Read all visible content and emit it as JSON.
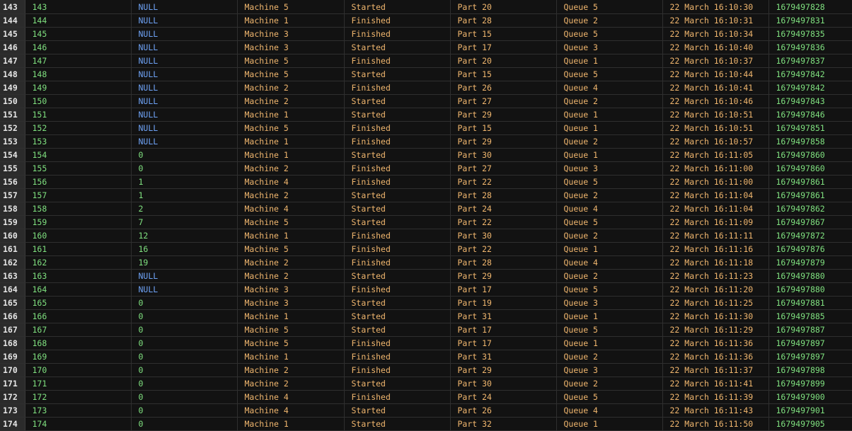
{
  "colors": {
    "background": "#121212",
    "row_number_bg": "#2b2b2b",
    "numeric": "#7fe07f",
    "null": "#6ea2f5",
    "string": "#f0b66e"
  },
  "rows": [
    {
      "rn": "143",
      "id": "143",
      "v": "NULL",
      "machine": "Machine 5",
      "status": "Started",
      "part": "Part 20",
      "queue": "Queue 5",
      "date": "22 March 16:10:30",
      "ts": "1679497828"
    },
    {
      "rn": "144",
      "id": "144",
      "v": "NULL",
      "machine": "Machine 1",
      "status": "Finished",
      "part": "Part 28",
      "queue": "Queue 2",
      "date": "22 March 16:10:31",
      "ts": "1679497831"
    },
    {
      "rn": "145",
      "id": "145",
      "v": "NULL",
      "machine": "Machine 3",
      "status": "Finished",
      "part": "Part 15",
      "queue": "Queue 5",
      "date": "22 March 16:10:34",
      "ts": "1679497835"
    },
    {
      "rn": "146",
      "id": "146",
      "v": "NULL",
      "machine": "Machine 3",
      "status": "Started",
      "part": "Part 17",
      "queue": "Queue 3",
      "date": "22 March 16:10:40",
      "ts": "1679497836"
    },
    {
      "rn": "147",
      "id": "147",
      "v": "NULL",
      "machine": "Machine 5",
      "status": "Finished",
      "part": "Part 20",
      "queue": "Queue 1",
      "date": "22 March 16:10:37",
      "ts": "1679497837"
    },
    {
      "rn": "148",
      "id": "148",
      "v": "NULL",
      "machine": "Machine 5",
      "status": "Started",
      "part": "Part 15",
      "queue": "Queue 5",
      "date": "22 March 16:10:44",
      "ts": "1679497842"
    },
    {
      "rn": "149",
      "id": "149",
      "v": "NULL",
      "machine": "Machine 2",
      "status": "Finished",
      "part": "Part 26",
      "queue": "Queue 4",
      "date": "22 March 16:10:41",
      "ts": "1679497842"
    },
    {
      "rn": "150",
      "id": "150",
      "v": "NULL",
      "machine": "Machine 2",
      "status": "Started",
      "part": "Part 27",
      "queue": "Queue 2",
      "date": "22 March 16:10:46",
      "ts": "1679497843"
    },
    {
      "rn": "151",
      "id": "151",
      "v": "NULL",
      "machine": "Machine 1",
      "status": "Started",
      "part": "Part 29",
      "queue": "Queue 1",
      "date": "22 March 16:10:51",
      "ts": "1679497846"
    },
    {
      "rn": "152",
      "id": "152",
      "v": "NULL",
      "machine": "Machine 5",
      "status": "Finished",
      "part": "Part 15",
      "queue": "Queue 1",
      "date": "22 March 16:10:51",
      "ts": "1679497851"
    },
    {
      "rn": "153",
      "id": "153",
      "v": "NULL",
      "machine": "Machine 1",
      "status": "Finished",
      "part": "Part 29",
      "queue": "Queue 2",
      "date": "22 March 16:10:57",
      "ts": "1679497858"
    },
    {
      "rn": "154",
      "id": "154",
      "v": "0",
      "machine": "Machine 1",
      "status": "Started",
      "part": "Part 30",
      "queue": "Queue 1",
      "date": "22 March 16:11:05",
      "ts": "1679497860"
    },
    {
      "rn": "155",
      "id": "155",
      "v": "0",
      "machine": "Machine 2",
      "status": "Finished",
      "part": "Part 27",
      "queue": "Queue 3",
      "date": "22 March 16:11:00",
      "ts": "1679497860"
    },
    {
      "rn": "156",
      "id": "156",
      "v": "1",
      "machine": "Machine 4",
      "status": "Finished",
      "part": "Part 22",
      "queue": "Queue 5",
      "date": "22 March 16:11:00",
      "ts": "1679497861"
    },
    {
      "rn": "157",
      "id": "157",
      "v": "1",
      "machine": "Machine 2",
      "status": "Started",
      "part": "Part 28",
      "queue": "Queue 2",
      "date": "22 March 16:11:04",
      "ts": "1679497861"
    },
    {
      "rn": "158",
      "id": "158",
      "v": "2",
      "machine": "Machine 4",
      "status": "Started",
      "part": "Part 24",
      "queue": "Queue 4",
      "date": "22 March 16:11:04",
      "ts": "1679497862"
    },
    {
      "rn": "159",
      "id": "159",
      "v": "7",
      "machine": "Machine 5",
      "status": "Started",
      "part": "Part 22",
      "queue": "Queue 5",
      "date": "22 March 16:11:09",
      "ts": "1679497867"
    },
    {
      "rn": "160",
      "id": "160",
      "v": "12",
      "machine": "Machine 1",
      "status": "Finished",
      "part": "Part 30",
      "queue": "Queue 2",
      "date": "22 March 16:11:11",
      "ts": "1679497872"
    },
    {
      "rn": "161",
      "id": "161",
      "v": "16",
      "machine": "Machine 5",
      "status": "Finished",
      "part": "Part 22",
      "queue": "Queue 1",
      "date": "22 March 16:11:16",
      "ts": "1679497876"
    },
    {
      "rn": "162",
      "id": "162",
      "v": "19",
      "machine": "Machine 2",
      "status": "Finished",
      "part": "Part 28",
      "queue": "Queue 4",
      "date": "22 March 16:11:18",
      "ts": "1679497879"
    },
    {
      "rn": "163",
      "id": "163",
      "v": "NULL",
      "machine": "Machine 2",
      "status": "Started",
      "part": "Part 29",
      "queue": "Queue 2",
      "date": "22 March 16:11:23",
      "ts": "1679497880"
    },
    {
      "rn": "164",
      "id": "164",
      "v": "NULL",
      "machine": "Machine 3",
      "status": "Finished",
      "part": "Part 17",
      "queue": "Queue 5",
      "date": "22 March 16:11:20",
      "ts": "1679497880"
    },
    {
      "rn": "165",
      "id": "165",
      "v": "0",
      "machine": "Machine 3",
      "status": "Started",
      "part": "Part 19",
      "queue": "Queue 3",
      "date": "22 March 16:11:25",
      "ts": "1679497881"
    },
    {
      "rn": "166",
      "id": "166",
      "v": "0",
      "machine": "Machine 1",
      "status": "Started",
      "part": "Part 31",
      "queue": "Queue 1",
      "date": "22 March 16:11:30",
      "ts": "1679497885"
    },
    {
      "rn": "167",
      "id": "167",
      "v": "0",
      "machine": "Machine 5",
      "status": "Started",
      "part": "Part 17",
      "queue": "Queue 5",
      "date": "22 March 16:11:29",
      "ts": "1679497887"
    },
    {
      "rn": "168",
      "id": "168",
      "v": "0",
      "machine": "Machine 5",
      "status": "Finished",
      "part": "Part 17",
      "queue": "Queue 1",
      "date": "22 March 16:11:36",
      "ts": "1679497897"
    },
    {
      "rn": "169",
      "id": "169",
      "v": "0",
      "machine": "Machine 1",
      "status": "Finished",
      "part": "Part 31",
      "queue": "Queue 2",
      "date": "22 March 16:11:36",
      "ts": "1679497897"
    },
    {
      "rn": "170",
      "id": "170",
      "v": "0",
      "machine": "Machine 2",
      "status": "Finished",
      "part": "Part 29",
      "queue": "Queue 3",
      "date": "22 March 16:11:37",
      "ts": "1679497898"
    },
    {
      "rn": "171",
      "id": "171",
      "v": "0",
      "machine": "Machine 2",
      "status": "Started",
      "part": "Part 30",
      "queue": "Queue 2",
      "date": "22 March 16:11:41",
      "ts": "1679497899"
    },
    {
      "rn": "172",
      "id": "172",
      "v": "0",
      "machine": "Machine 4",
      "status": "Finished",
      "part": "Part 24",
      "queue": "Queue 5",
      "date": "22 March 16:11:39",
      "ts": "1679497900"
    },
    {
      "rn": "173",
      "id": "173",
      "v": "0",
      "machine": "Machine 4",
      "status": "Started",
      "part": "Part 26",
      "queue": "Queue 4",
      "date": "22 March 16:11:43",
      "ts": "1679497901"
    },
    {
      "rn": "174",
      "id": "174",
      "v": "0",
      "machine": "Machine 1",
      "status": "Started",
      "part": "Part 32",
      "queue": "Queue 1",
      "date": "22 March 16:11:50",
      "ts": "1679497905"
    }
  ]
}
